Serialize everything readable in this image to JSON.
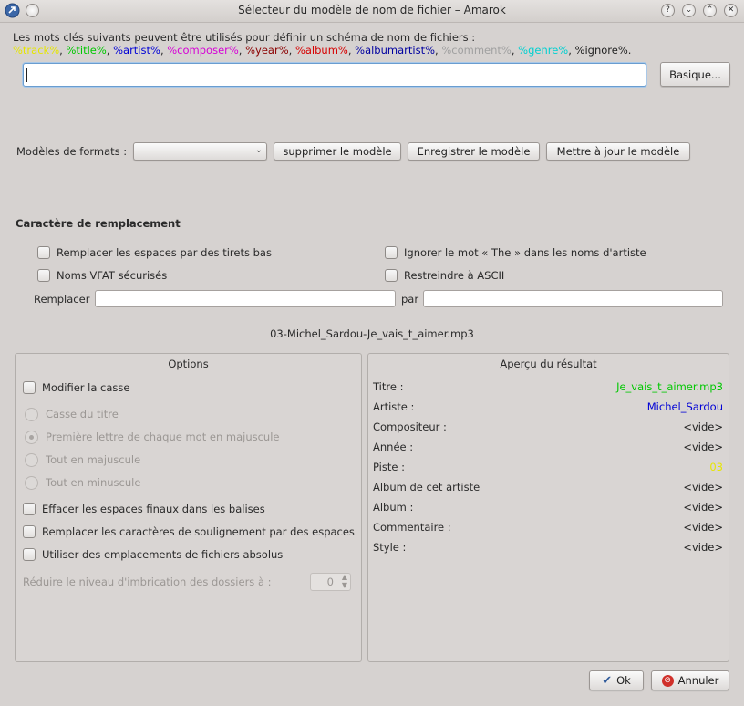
{
  "window": {
    "title": "Sélecteur du modèle de nom de fichier – Amarok",
    "controls": [
      "?",
      "⌄",
      "⌃",
      "✕"
    ]
  },
  "intro": {
    "text": "Les mots clés suivants peuvent être utilisés pour définir un schéma de nom de fichiers :",
    "keywords": [
      {
        "text": "%track%",
        "color": "#e6e600"
      },
      {
        "text": "%title%",
        "color": "#00c800"
      },
      {
        "text": "%artist%",
        "color": "#0000d6"
      },
      {
        "text": "%composer%",
        "color": "#d600d6"
      },
      {
        "text": "%year%",
        "color": "#8b0000"
      },
      {
        "text": "%album%",
        "color": "#d60000"
      },
      {
        "text": "%albumartist%",
        "color": "#0000a0"
      },
      {
        "text": "%comment%",
        "color": "#a0a0a0"
      },
      {
        "text": "%genre%",
        "color": "#00d0d0"
      },
      {
        "text": "%ignore%",
        "color": "#222222"
      }
    ],
    "separator": ", ",
    "trailing": "."
  },
  "pattern_input": {
    "value": ""
  },
  "basic_button": "Basique...",
  "formats": {
    "label": "Modèles de formats :",
    "selected": "",
    "delete_button": "supprimer le modèle",
    "save_button": "Enregistrer le modèle",
    "update_button": "Mettre à jour le modèle"
  },
  "replace": {
    "heading": "Caractère de remplacement",
    "opt_spaces": "Remplacer les espaces par des tirets bas",
    "opt_the": "Ignorer le mot « The » dans les noms d'artiste",
    "opt_vfat": "Noms VFAT sécurisés",
    "opt_ascii": "Restreindre à ASCII",
    "replace_label": "Remplacer",
    "par_label": "par",
    "replace_value": "",
    "par_value": ""
  },
  "preview_filename": "03-Michel_Sardou-Je_vais_t_aimer.mp3",
  "options": {
    "title": "Options",
    "modify_case": "Modifier la casse",
    "case_title": "Casse du titre",
    "case_first": "Première lettre de chaque mot en majuscule",
    "case_upper": "Tout en majuscule",
    "case_lower": "Tout en minuscule",
    "trim_spaces": "Effacer les espaces finaux dans les balises",
    "underscore": "Remplacer les caractères de soulignement par des espaces",
    "absolute": "Utiliser des emplacements de fichiers absolus",
    "nesting_label": "Réduire le niveau d'imbrication des dossiers à :",
    "nesting_value": "0"
  },
  "result": {
    "title": "Aperçu du résultat",
    "rows": [
      {
        "label": "Titre :",
        "value": "Je_vais_t_aimer.mp3",
        "color": "#00c800"
      },
      {
        "label": "Artiste :",
        "value": "Michel_Sardou",
        "color": "#0000d6"
      },
      {
        "label": "Compositeur :",
        "value": "<vide>",
        "color": "#222222"
      },
      {
        "label": "Année :",
        "value": "<vide>",
        "color": "#222222"
      },
      {
        "label": "Piste :",
        "value": "03",
        "color": "#e6e600"
      },
      {
        "label": "Album de cet artiste",
        "value": "<vide>",
        "color": "#222222"
      },
      {
        "label": "Album :",
        "value": "<vide>",
        "color": "#222222"
      },
      {
        "label": "Commentaire :",
        "value": "<vide>",
        "color": "#222222"
      },
      {
        "label": "Style :",
        "value": "<vide>",
        "color": "#222222"
      }
    ]
  },
  "footer": {
    "ok": "Ok",
    "cancel": "Annuler"
  }
}
